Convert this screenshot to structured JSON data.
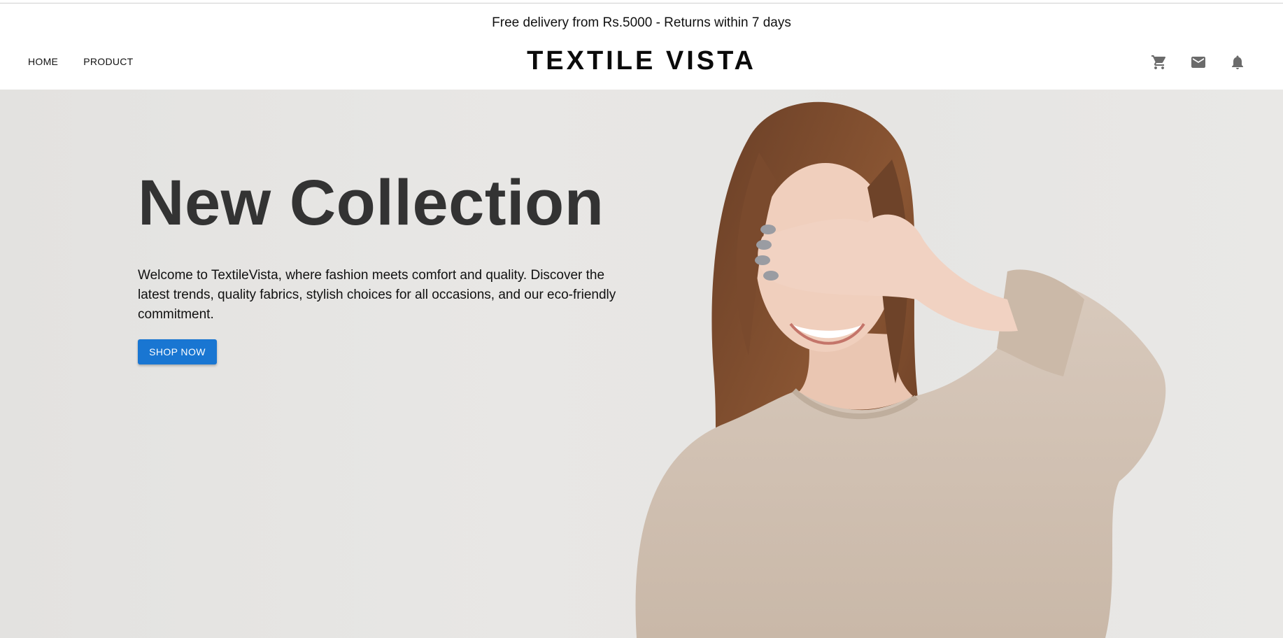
{
  "announcement": "Free delivery from Rs.5000 - Returns within 7 days",
  "nav": {
    "links": [
      "HOME",
      "PRODUCT"
    ],
    "brand": "TEXTILE VISTA",
    "icons": [
      "cart-icon",
      "mail-icon",
      "bell-icon"
    ]
  },
  "hero": {
    "title": "New Collection",
    "description": "Welcome to TextileVista, where fashion meets comfort and quality. Discover the latest trends, quality fabrics, stylish choices for all occasions, and our eco-friendly commitment.",
    "button_label": "SHOP NOW",
    "image_subject": "smiling woman in beige knit sweater covering her eyes with one hand"
  },
  "colors": {
    "accent": "#1976d2",
    "hero_background": "#e6e5e3",
    "title_text": "#333333"
  }
}
